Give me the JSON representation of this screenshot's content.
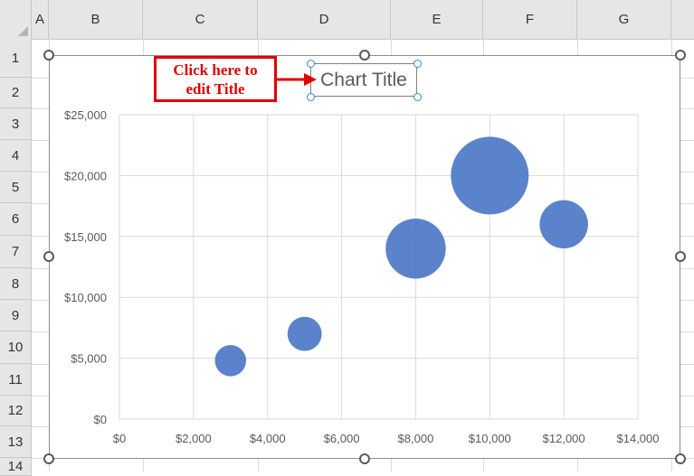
{
  "spreadsheet": {
    "columns": [
      "A",
      "B",
      "C",
      "D",
      "E",
      "F",
      "G"
    ],
    "rows": [
      "1",
      "2",
      "3",
      "4",
      "5",
      "6",
      "7",
      "8",
      "9",
      "10",
      "11",
      "12",
      "13",
      "14"
    ]
  },
  "chart": {
    "title_placeholder": "Chart Title"
  },
  "callout": {
    "line1": "Click here to",
    "line2": "edit Title"
  },
  "colors": {
    "bubble": "#4472c4",
    "callout": "#e00000"
  },
  "chart_data": {
    "type": "bubble",
    "title": "Chart Title",
    "xlim": [
      0,
      14000
    ],
    "ylim": [
      0,
      25000
    ],
    "x_ticks": [
      "$0",
      "$2,000",
      "$4,000",
      "$6,000",
      "$8,000",
      "$10,000",
      "$12,000",
      "$14,000"
    ],
    "y_ticks": [
      "$0",
      "$5,000",
      "$10,000",
      "$15,000",
      "$20,000",
      "$25,000"
    ],
    "grid": true,
    "series": [
      {
        "points": [
          {
            "x": 3000,
            "y": 4800,
            "size": 1
          },
          {
            "x": 5000,
            "y": 7000,
            "size": 1.2
          },
          {
            "x": 8000,
            "y": 14000,
            "size": 3.7
          },
          {
            "x": 10000,
            "y": 20000,
            "size": 6.2
          },
          {
            "x": 12000,
            "y": 16000,
            "size": 2.4
          }
        ]
      }
    ]
  }
}
